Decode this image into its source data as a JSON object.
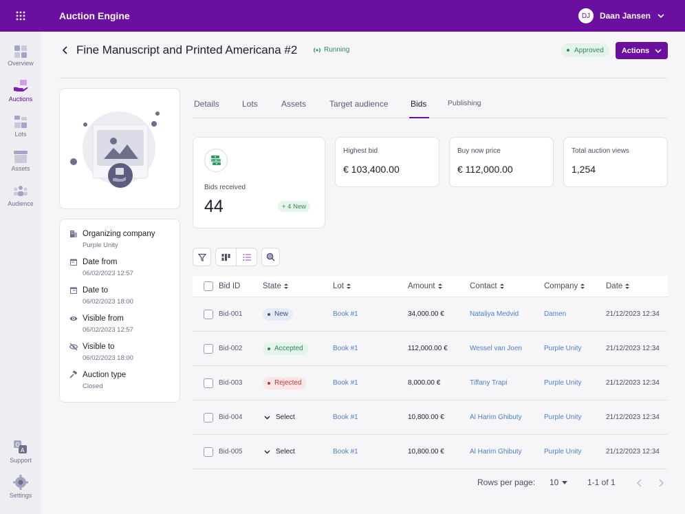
{
  "topbar": {
    "app_title": "Auction Engine",
    "user_initials": "DJ",
    "user_name": "Daan Jansen",
    "brand_color": "#6a0fa0"
  },
  "sidebar": {
    "items": [
      {
        "label": "Overview",
        "icon": "overview-icon",
        "active": false
      },
      {
        "label": "Auctions",
        "icon": "auctions-icon",
        "active": true
      },
      {
        "label": "Lots",
        "icon": "lots-icon",
        "active": false
      },
      {
        "label": "Assets",
        "icon": "assets-icon",
        "active": false
      },
      {
        "label": "Audience",
        "icon": "audience-icon",
        "active": false
      },
      {
        "label": "Support",
        "icon": "support-icon",
        "active": false
      },
      {
        "label": "Settings",
        "icon": "settings-icon",
        "active": false
      }
    ]
  },
  "header": {
    "title": "Fine Manuscript and Printed Americana #2",
    "running_label": "Running",
    "approved_label": "Approved",
    "actions_label": "Actions"
  },
  "info": {
    "rows": [
      {
        "label": "Organizing company",
        "value": "Purple Unity",
        "icon": "building-icon"
      },
      {
        "label": "Date from",
        "value": "06/02/2023 12:57",
        "icon": "calendar-icon"
      },
      {
        "label": "Date to",
        "value": "06/02/2023 18:00",
        "icon": "calendar-icon"
      },
      {
        "label": "Visible from",
        "value": "06/02/2023 12:57",
        "icon": "eye-icon"
      },
      {
        "label": "Visible to",
        "value": "06/02/2023 18:00",
        "icon": "eye-off-icon"
      },
      {
        "label": "Auction type",
        "value": "Closed",
        "icon": "gavel-icon"
      }
    ]
  },
  "tabs": [
    "Details",
    "Lots",
    "Assets",
    "Target audience",
    "Bids",
    "Publishing"
  ],
  "active_tab": "Bids",
  "kpis": {
    "bids_received_label": "Bids received",
    "bids_received_value": "44",
    "new_badge": "+ 4 New",
    "highest_bid_label": "Highest bid",
    "highest_bid_value": "€ 103,400.00",
    "buy_now_label": "Buy now price",
    "buy_now_value": "€ 112,000.00",
    "views_label": "Total auction views",
    "views_value": "1,254"
  },
  "table": {
    "headers": {
      "bid_id": "Bid ID",
      "state": "State",
      "lot": "Lot",
      "amount": "Amount",
      "contact": "Contact",
      "company": "Company",
      "date": "Date"
    },
    "rows": [
      {
        "bid_id": "Bid-001",
        "state": "New",
        "state_type": "badge-new",
        "lot": "Book #1",
        "amount": "34,000.00 €",
        "contact": "Nataliya Medvid",
        "company": "Damen",
        "date": "21/12/2023 12:34"
      },
      {
        "bid_id": "Bid-002",
        "state": "Accepted",
        "state_type": "badge-accepted",
        "lot": "Book #1",
        "amount": "112,000.00 €",
        "contact": "Wessel van Joen",
        "company": "Purple Unity",
        "date": "21/12/2023 12:34"
      },
      {
        "bid_id": "Bid-003",
        "state": "Rejected",
        "state_type": "badge-rejected",
        "lot": "Book #1",
        "amount": "8,000.00 €",
        "contact": "Tiffany Trapi",
        "company": "Purple Unity",
        "date": "21/12/2023 12:34"
      },
      {
        "bid_id": "Bid-004",
        "state": "Select",
        "state_type": "select",
        "lot": "Book #1",
        "amount": "10,800.00 €",
        "contact": "Al Harim Ghibuty",
        "company": "Purple Unity",
        "date": "21/12/2023 12:34"
      },
      {
        "bid_id": "Bid-005",
        "state": "Select",
        "state_type": "select",
        "lot": "Book #1",
        "amount": "10,800.00 €",
        "contact": "Al Harim Ghibuty",
        "company": "Purple Unity",
        "date": "21/12/2023 12:34"
      }
    ]
  },
  "pagination": {
    "rows_per_page_label": "Rows per page:",
    "rows_per_page_value": "10",
    "range": "1-1 of 1"
  }
}
